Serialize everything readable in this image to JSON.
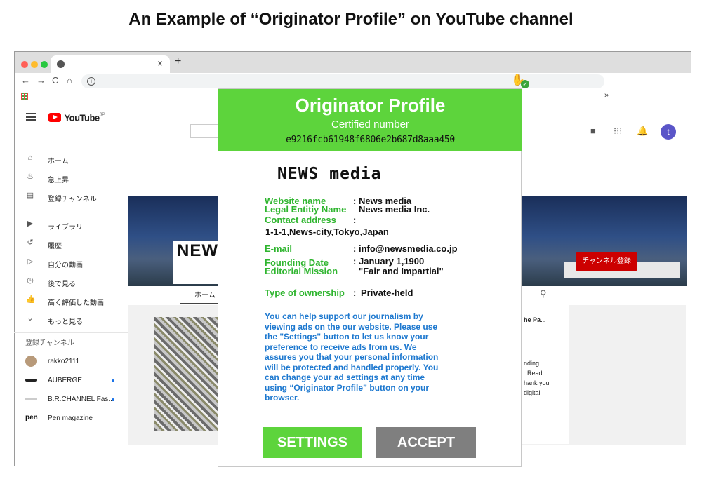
{
  "figure_title": "An Example of “Originator Profile” on YouTube channel",
  "browser": {
    "window_dots": [
      "#ff5f57",
      "#febc2e",
      "#28c840"
    ],
    "tab_close": "×",
    "new_tab": "+",
    "nav": {
      "back": "←",
      "forward": "→",
      "reload": "C",
      "home": "⌂"
    },
    "info": "i",
    "more_bookmarks": "»",
    "badge_check": "✓"
  },
  "youtube": {
    "logo_text": "YouTube",
    "logo_region": "JP",
    "avatar_letter": "t",
    "sidebar_primary": [
      {
        "icon": "home-icon",
        "glyph": "⌂",
        "label": "ホーム"
      },
      {
        "icon": "trending-icon",
        "glyph": "♨",
        "label": "急上昇"
      },
      {
        "icon": "subscriptions-icon",
        "glyph": "▤",
        "label": "登録チャンネル"
      }
    ],
    "sidebar_library": [
      {
        "icon": "library-icon",
        "glyph": "▶",
        "label": "ライブラリ"
      },
      {
        "icon": "history-icon",
        "glyph": "↺",
        "label": "履歴"
      },
      {
        "icon": "your-videos-icon",
        "glyph": "▷",
        "label": "自分の動画"
      },
      {
        "icon": "watch-later-icon",
        "glyph": "◷",
        "label": "後で見る"
      },
      {
        "icon": "liked-videos-icon",
        "glyph": "👍",
        "label": "高く評価した動画"
      },
      {
        "icon": "chevron-down-icon",
        "glyph": "⌄",
        "label": "もっと見る"
      }
    ],
    "subscriptions_heading": "登録チャンネル",
    "subscriptions": [
      {
        "label": "rakko2111",
        "new": false
      },
      {
        "label": "AUBERGE",
        "new": true
      },
      {
        "label": "B.R.CHANNEL Fas...",
        "new": true
      },
      {
        "label": "Pen magazine",
        "new": false
      }
    ],
    "channel_name_partial": "NEW",
    "subscribe_label": "チャンネル登録",
    "home_tab": "ホーム",
    "right_snippets": [
      "he Pa...",
      "nding",
      ". Read",
      "hank you",
      "digital"
    ]
  },
  "originator_profile": {
    "title": "Originator Profile",
    "certified_label": "Certified number",
    "certified_number": "e9216fcb61948f6806e2b687d8aaa450",
    "organization": "NEWS media",
    "fields": [
      {
        "label": "Website name",
        "value": "News media"
      },
      {
        "label": "Legal Entitiy Name",
        "value": "News media Inc."
      },
      {
        "label": "Contact address",
        "value": ""
      },
      {
        "label": "E-mail",
        "value": "info@newsmedia.co.jp"
      },
      {
        "label": "Founding Date",
        "value": "January 1,1900"
      },
      {
        "label": "Editorial Mission",
        "value": "\"Fair and Impartial\""
      },
      {
        "label": "Type of ownership",
        "value": "Private-held"
      }
    ],
    "address": "1-1-1,News-city,Tokyo,Japan",
    "colon": ":",
    "message": "You can help support our journalism by viewing ads on the our website. Please use the \"Settings\" button to let us know your preference to receive ads from us. We assures you that your personal information will be protected and handled properly. You can change your ad settings at any time using “Originator Profile” button on your browser.",
    "settings_button": "SETTINGS",
    "accept_button": "ACCEPT",
    "colors": {
      "header": "#5dd43c",
      "label": "#2fb52f",
      "message": "#1d78cf",
      "accept": "#7f7f7f"
    }
  }
}
